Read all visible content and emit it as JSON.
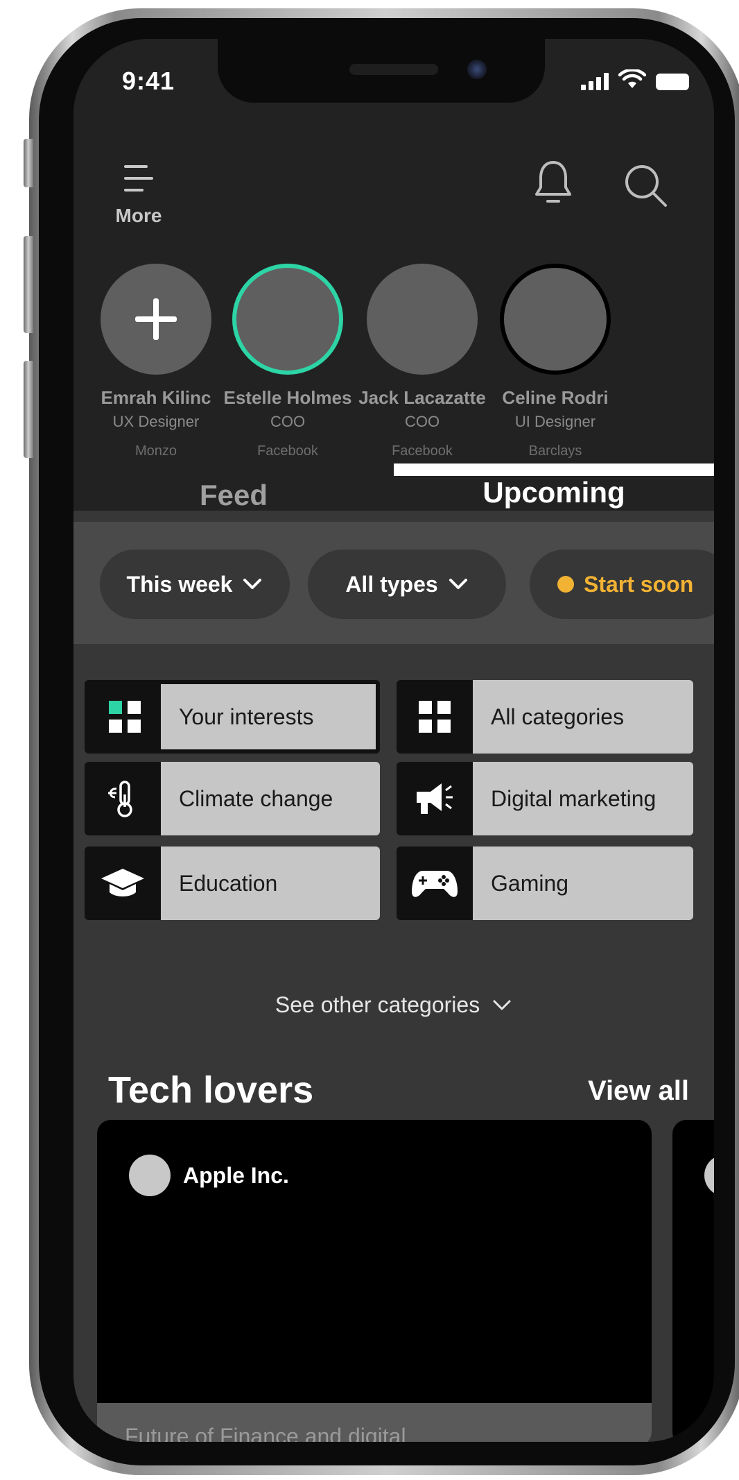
{
  "status_bar": {
    "time": "9:41"
  },
  "header": {
    "more_label": "More"
  },
  "contacts": [
    {
      "name": "Emrah Kilinc",
      "role": "UX Designer",
      "company": "Monzo",
      "is_add": true
    },
    {
      "name": "Estelle Holmes",
      "role": "COO",
      "company": "Facebook"
    },
    {
      "name": "Jack Lacazatte",
      "role": "COO",
      "company": "Facebook"
    },
    {
      "name": "Celine Rodri",
      "role": "UI Designer",
      "company": "Barclays"
    }
  ],
  "tabs": [
    {
      "label": "Feed",
      "active": false
    },
    {
      "label": "Upcoming",
      "active": true
    }
  ],
  "filters": [
    {
      "label": "This week"
    },
    {
      "label": "All types"
    },
    {
      "label": "Start soon",
      "color": "#f2b233"
    }
  ],
  "categories": [
    {
      "label": "Your interests",
      "icon": "grid-icon",
      "selected": true
    },
    {
      "label": "All categories",
      "icon": "grid-icon"
    },
    {
      "label": "Climate change",
      "icon": "thermometer-icon"
    },
    {
      "label": "Digital marketing",
      "icon": "megaphone-icon"
    },
    {
      "label": "Education",
      "icon": "graduation-cap-icon"
    },
    {
      "label": "Gaming",
      "icon": "gamepad-icon"
    }
  ],
  "see_other": "See other categories",
  "section": {
    "title": "Tech lovers",
    "view_all": "View all",
    "cards": [
      {
        "org": "Apple Inc.",
        "footer": "Future of Finance and digital"
      }
    ]
  },
  "colors": {
    "accent_green": "#2dd4a5",
    "accent_yellow": "#f2b233",
    "header_bg": "#222222",
    "content_bg": "#373737"
  }
}
